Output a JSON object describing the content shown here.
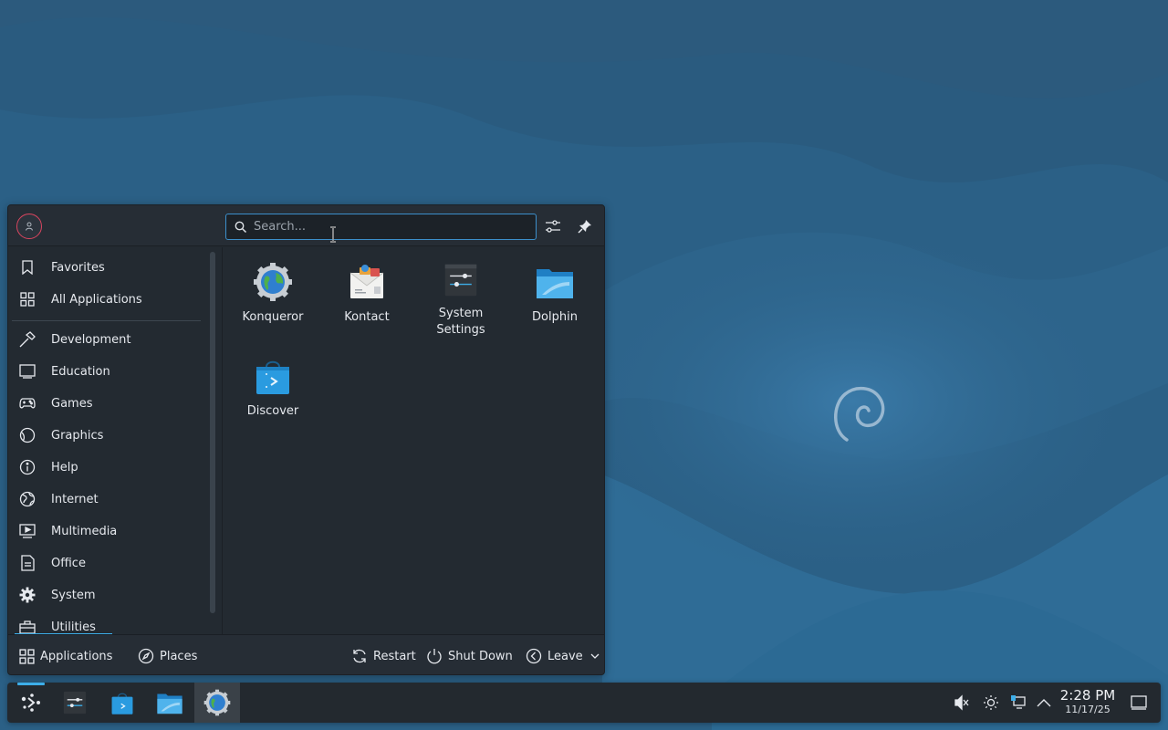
{
  "launcher": {
    "search": {
      "placeholder": "Search..."
    },
    "sidebar": {
      "items": [
        {
          "label": "Favorites",
          "icon": "bookmark-icon"
        },
        {
          "label": "All Applications",
          "icon": "grid-icon"
        },
        {
          "label": "Development",
          "icon": "hammer-icon"
        },
        {
          "label": "Education",
          "icon": "monitor-icon"
        },
        {
          "label": "Games",
          "icon": "gamepad-icon"
        },
        {
          "label": "Graphics",
          "icon": "palette-icon"
        },
        {
          "label": "Help",
          "icon": "info-icon"
        },
        {
          "label": "Internet",
          "icon": "globe-icon"
        },
        {
          "label": "Multimedia",
          "icon": "media-icon"
        },
        {
          "label": "Office",
          "icon": "document-icon"
        },
        {
          "label": "System",
          "icon": "gear-icon"
        },
        {
          "label": "Utilities",
          "icon": "toolbox-icon"
        }
      ]
    },
    "apps": [
      {
        "label": "Konqueror",
        "icon": "konqueror-icon"
      },
      {
        "label": "Kontact",
        "icon": "kontact-icon"
      },
      {
        "label": "System Settings",
        "icon": "system-settings-icon"
      },
      {
        "label": "Dolphin",
        "icon": "dolphin-folder-icon"
      },
      {
        "label": "Discover",
        "icon": "discover-bag-icon"
      }
    ],
    "footer": {
      "applications_label": "Applications",
      "places_label": "Places",
      "restart_label": "Restart",
      "shutdown_label": "Shut Down",
      "leave_label": "Leave"
    }
  },
  "taskbar": {
    "clock": {
      "time": "2:28 PM",
      "date": "11/17/25"
    }
  },
  "colors": {
    "accent": "#3daee9",
    "panel": "#232a31",
    "wallpaper": "#2c6187",
    "avatar_ring": "#d9455f"
  }
}
